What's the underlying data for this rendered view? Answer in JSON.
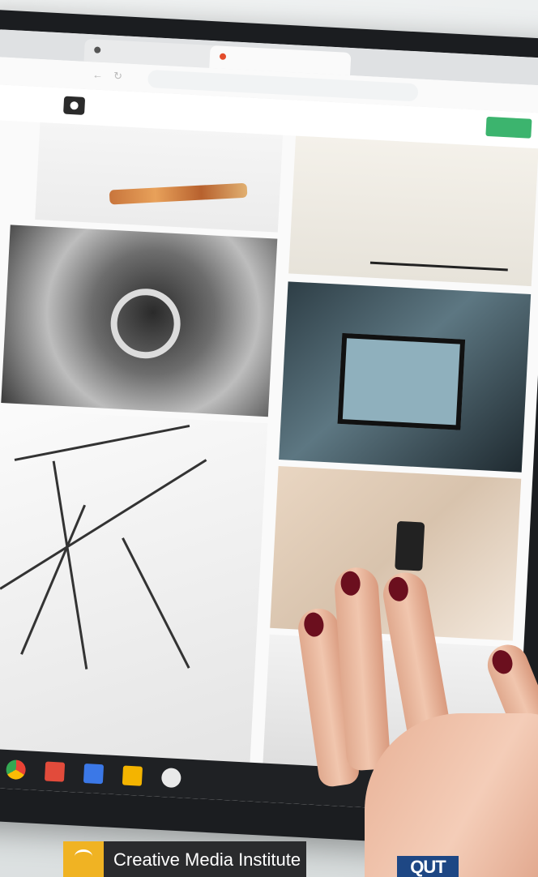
{
  "logos": {
    "left_text": "Creative Media Institute",
    "right_text": "QUT"
  },
  "colors": {
    "brand_gold": "#f0b323",
    "brand_dark": "#2a2b2d",
    "qut_blue": "#1e4784",
    "join_green": "#3cb46e",
    "nail_polish": "#6b0f1e"
  },
  "icons": [
    "camera-icon",
    "chrome-icon",
    "gmail-icon",
    "docs-icon",
    "slides-icon",
    "photos-icon"
  ]
}
